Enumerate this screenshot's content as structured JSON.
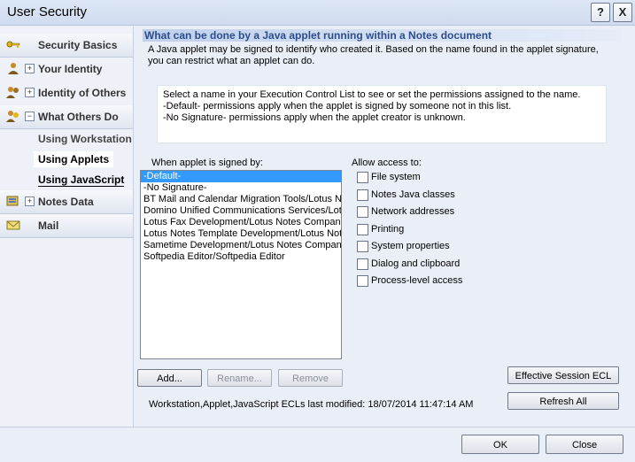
{
  "window": {
    "title": "User Security",
    "help_glyph": "?",
    "close_glyph": "X"
  },
  "sidebar": {
    "items": [
      {
        "label": "Security Basics",
        "icon": "key-icon",
        "expander": ""
      },
      {
        "label": "Your Identity",
        "icon": "person-icon",
        "expander": "+"
      },
      {
        "label": "Identity of Others",
        "icon": "people-icon",
        "expander": "+"
      },
      {
        "label": "What Others Do",
        "icon": "group-icon",
        "expander": "−"
      },
      {
        "label": "Notes Data",
        "icon": "database-icon",
        "expander": "+"
      },
      {
        "label": "Mail",
        "icon": "envelope-icon",
        "expander": ""
      }
    ],
    "subitems": [
      "Using Workstation",
      "Using Applets",
      "Using JavaScript"
    ]
  },
  "main": {
    "header": "What can be done by a Java applet running within a Notes document",
    "description": "A Java applet may be signed to identify who created it.  Based on the name found in the applet signature, you can restrict what an applet can do.",
    "info_lines": [
      "Select a name in your Execution Control List to see or set the permissions assigned to the name.",
      "-Default- permissions apply when the applet is signed by someone not in this list.",
      "-No Signature- permissions apply when the applet creator is unknown."
    ],
    "signed_label": "When applet is signed by:",
    "signers": [
      "-Default-",
      "-No Signature-",
      "BT Mail and Calendar Migration Tools/Lotus Notes",
      "Domino Unified Communications Services/Lotus Notes",
      "Lotus Fax Development/Lotus Notes Companion",
      "Lotus Notes Template Development/Lotus Notes",
      "Sametime Development/Lotus Notes Companion",
      "Softpedia Editor/Softpedia Editor"
    ],
    "allow_label": "Allow access to:",
    "permissions": [
      "File system",
      "Notes Java classes",
      "Network addresses",
      "Printing",
      "System properties",
      "Dialog and clipboard",
      "Process-level access"
    ],
    "buttons": {
      "add": "Add...",
      "rename": "Rename...",
      "remove": "Remove",
      "effective": "Effective Session ECL",
      "refresh": "Refresh All"
    },
    "status": "Workstation,Applet,JavaScript ECLs last modified:  18/07/2014 11:47:14 AM"
  },
  "footer": {
    "ok": "OK",
    "close": "Close"
  }
}
